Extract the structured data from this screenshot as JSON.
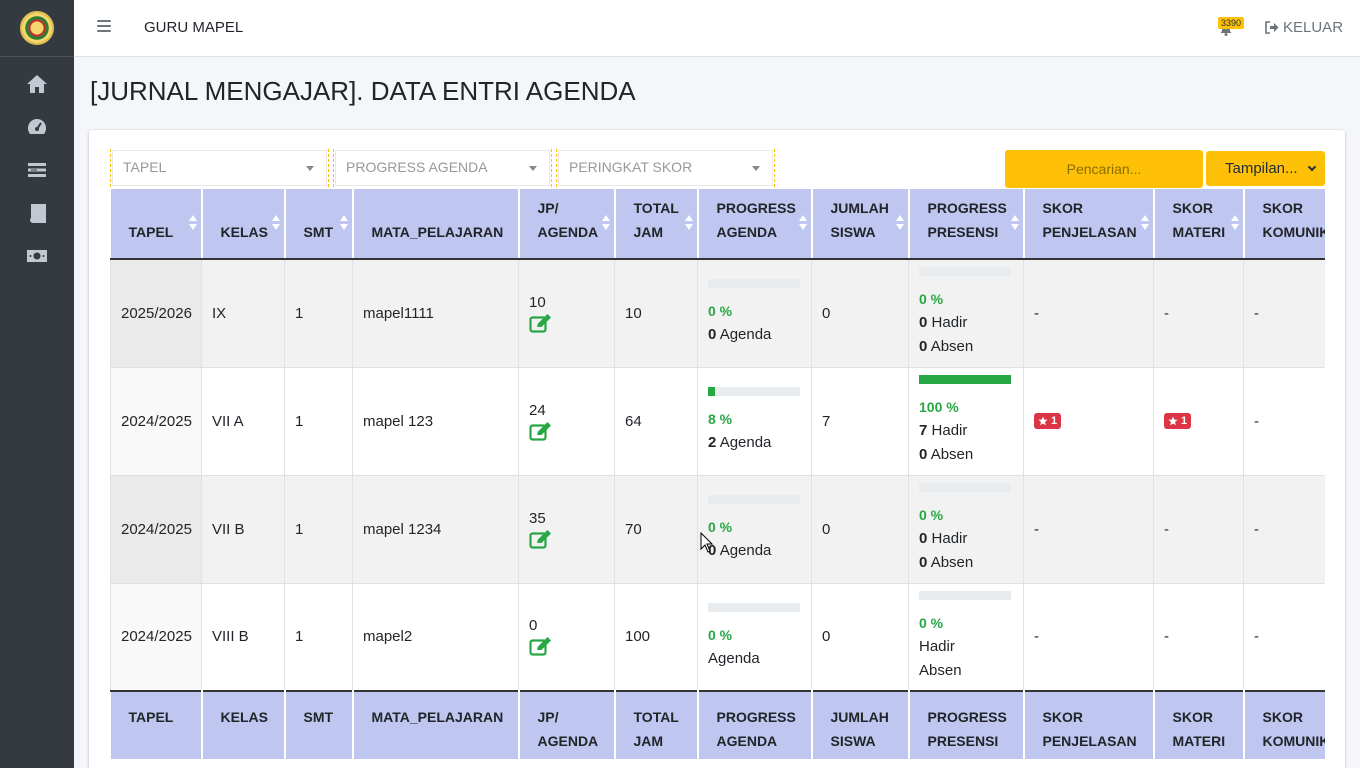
{
  "header": {
    "role_label": "GURU MAPEL",
    "notification_count": "3390",
    "logout_label": "KELUAR"
  },
  "sidebar": {
    "items": [
      {
        "icon": "home-icon"
      },
      {
        "icon": "dashboard-gauge-icon"
      },
      {
        "icon": "list-icon"
      },
      {
        "icon": "book-icon"
      },
      {
        "icon": "money-icon"
      }
    ]
  },
  "page": {
    "title": "[JURNAL MENGAJAR]. DATA ENTRI AGENDA"
  },
  "filters": {
    "tapel_placeholder": "TAPEL",
    "progress_placeholder": "PROGRESS AGENDA",
    "peringkat_placeholder": "PERINGKAT SKOR",
    "search_placeholder": "Pencarian...",
    "tampilan_label": "Tampilan..."
  },
  "table": {
    "headers": {
      "tapel": "TAPEL",
      "kelas": "KELAS",
      "smt": "SMT",
      "mapel": "MATA_PELAJARAN",
      "jp1": "JP/",
      "jp2": "AGENDA",
      "total1": "TOTAL",
      "total2": "JAM",
      "pa1": "PROGRESS",
      "pa2": "AGENDA",
      "js1": "JUMLAH",
      "js2": "SISWA",
      "pp1": "PROGRESS",
      "pp2": "PRESENSI",
      "sp1": "SKOR",
      "sp2": "PENJELASAN",
      "sm1": "SKOR",
      "sm2": "MATERI",
      "sk1": "SKOR",
      "sk2": "KOMUNIKASI"
    },
    "agenda_word": "Agenda",
    "hadir_word": "Hadir",
    "absen_word": "Absen",
    "rows": [
      {
        "tapel": "2025/2026",
        "kelas": "IX",
        "smt": "1",
        "mapel": "mapel1111",
        "jp": "10",
        "total": "10",
        "agenda_pct": "0 %",
        "agenda_progress": 0,
        "agenda_count": "0",
        "siswa": "0",
        "presensi_pct": "0 %",
        "presensi_progress": 0,
        "hadir": "0",
        "absen": "0",
        "skor_penjelasan": "-",
        "skor_materi": "-",
        "skor_komunikasi": "-"
      },
      {
        "tapel": "2024/2025",
        "kelas": "VII A",
        "smt": "1",
        "mapel": "mapel 123",
        "jp": "24",
        "total": "64",
        "agenda_pct": "8 %",
        "agenda_progress": 8,
        "agenda_count": "2",
        "siswa": "7",
        "presensi_pct": "100 %",
        "presensi_progress": 100,
        "hadir": "7",
        "absen": "0",
        "skor_penjelasan": "1",
        "skor_materi": "1",
        "skor_komunikasi": "-"
      },
      {
        "tapel": "2024/2025",
        "kelas": "VII B",
        "smt": "1",
        "mapel": "mapel 1234",
        "jp": "35",
        "total": "70",
        "agenda_pct": "0 %",
        "agenda_progress": 0,
        "agenda_count": "0",
        "siswa": "0",
        "presensi_pct": "0 %",
        "presensi_progress": 0,
        "hadir": "0",
        "absen": "0",
        "skor_penjelasan": "-",
        "skor_materi": "-",
        "skor_komunikasi": "-"
      },
      {
        "tapel": "2024/2025",
        "kelas": "VIII B",
        "smt": "1",
        "mapel": "mapel2",
        "jp": "0",
        "total": "100",
        "agenda_pct": "0 %",
        "agenda_progress": 0,
        "agenda_count": "",
        "siswa": "0",
        "presensi_pct": "0 %",
        "presensi_progress": 0,
        "hadir": "",
        "absen": "",
        "skor_penjelasan": "-",
        "skor_materi": "-",
        "skor_komunikasi": "-"
      }
    ]
  }
}
